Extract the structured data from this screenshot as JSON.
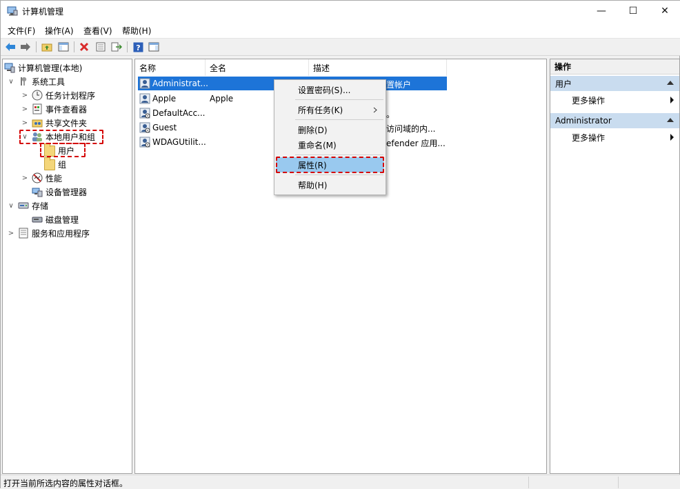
{
  "window": {
    "title": "计算机管理",
    "minimize_glyph": "—",
    "maximize_glyph": "☐",
    "close_glyph": "✕"
  },
  "menu": [
    "文件(F)",
    "操作(A)",
    "查看(V)",
    "帮助(H)"
  ],
  "toolbar_icons": [
    "back-arrow-icon",
    "forward-arrow-icon",
    "up-folder-icon",
    "show-tree-icon",
    "delete-icon",
    "properties-icon",
    "export-icon",
    "help-icon",
    "action-pane-icon"
  ],
  "tree": [
    {
      "label": "计算机管理(本地)",
      "expander": "",
      "icon": "computer-management-icon"
    },
    {
      "label": "系统工具",
      "expander": "∨",
      "icon": "tools-icon"
    },
    {
      "label": "任务计划程序",
      "expander": ">",
      "icon": "clock-icon"
    },
    {
      "label": "事件查看器",
      "expander": ">",
      "icon": "event-viewer-icon"
    },
    {
      "label": "共享文件夹",
      "expander": ">",
      "icon": "shared-folder-icon"
    },
    {
      "label": "本地用户和组",
      "expander": "∨",
      "icon": "users-group-icon"
    },
    {
      "label": "用户",
      "expander": "",
      "icon": "folder-icon"
    },
    {
      "label": "组",
      "expander": "",
      "icon": "folder-icon"
    },
    {
      "label": "性能",
      "expander": ">",
      "icon": "performance-icon"
    },
    {
      "label": "设备管理器",
      "expander": "",
      "icon": "device-manager-icon"
    },
    {
      "label": "存储",
      "expander": "∨",
      "icon": "storage-icon"
    },
    {
      "label": "磁盘管理",
      "expander": "",
      "icon": "disk-icon"
    },
    {
      "label": "服务和应用程序",
      "expander": ">",
      "icon": "services-icon"
    }
  ],
  "list": {
    "columns": [
      "名称",
      "全名",
      "描述"
    ],
    "rows": [
      {
        "name": "Administrat...",
        "fullname": "",
        "desc": "置帐户",
        "selected": true
      },
      {
        "name": "Apple",
        "fullname": "Apple",
        "desc": "",
        "selected": false
      },
      {
        "name": "DefaultAcc...",
        "fullname": "",
        "desc": "。",
        "selected": false
      },
      {
        "name": "Guest",
        "fullname": "",
        "desc": "访问域的内...",
        "selected": false
      },
      {
        "name": "WDAGUtilit...",
        "fullname": "",
        "desc": "efender 应用...",
        "selected": false
      }
    ]
  },
  "context_menu": {
    "items": [
      {
        "label": "设置密码(S)...",
        "submenu": false
      },
      {
        "label": "所有任务(K)",
        "submenu": true
      },
      {
        "label": "删除(D)",
        "submenu": false
      },
      {
        "label": "重命名(M)",
        "submenu": false
      },
      {
        "label": "属性(R)",
        "submenu": false,
        "highlighted": true
      },
      {
        "label": "帮助(H)",
        "submenu": false
      }
    ]
  },
  "actions": {
    "header": "操作",
    "sections": [
      {
        "title": "用户",
        "item": "更多操作"
      },
      {
        "title": "Administrator",
        "item": "更多操作"
      }
    ]
  },
  "status": {
    "text": "打开当前所选内容的属性对话框。"
  },
  "colors": {
    "selection": "#1d74d8",
    "menu_highlight": "#99c9ef",
    "annotation_dash": "#d40000",
    "action_section": "#c9dcef"
  }
}
